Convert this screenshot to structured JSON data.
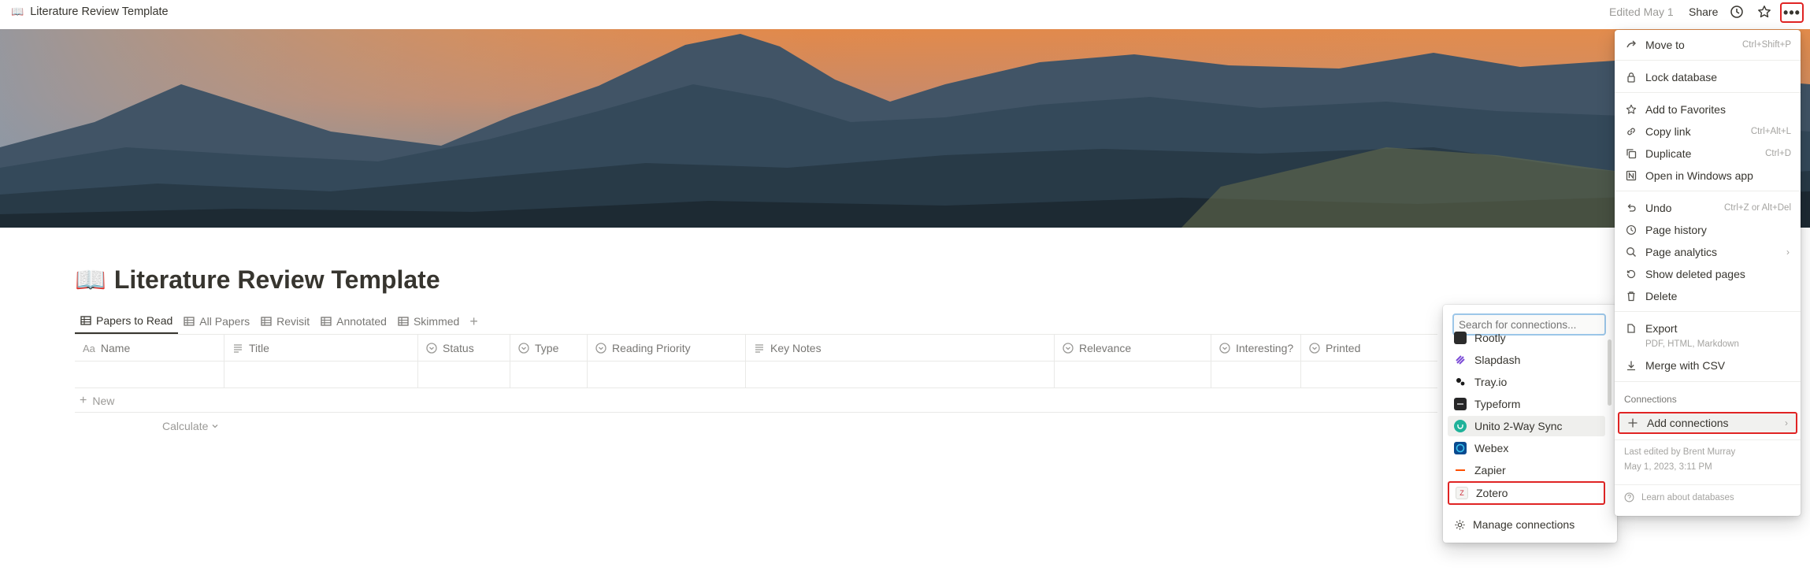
{
  "topbar": {
    "page_icon": "📖",
    "breadcrumb": "Literature Review Template",
    "edited": "Edited May 1",
    "share": "Share",
    "icons": [
      "history-icon",
      "star-icon",
      "more-icon"
    ]
  },
  "page": {
    "icon": "📖",
    "title": "Literature Review Template"
  },
  "tabs": [
    {
      "label": "Papers to Read",
      "active": true
    },
    {
      "label": "All Papers"
    },
    {
      "label": "Revisit"
    },
    {
      "label": "Annotated"
    },
    {
      "label": "Skimmed"
    }
  ],
  "table": {
    "columns": [
      {
        "icon": "Aa",
        "label": "Name"
      },
      {
        "icon": "text-icon",
        "label": "Title"
      },
      {
        "icon": "select-icon",
        "label": "Status"
      },
      {
        "icon": "select-icon",
        "label": "Type"
      },
      {
        "icon": "select-icon",
        "label": "Reading Priority"
      },
      {
        "icon": "text-icon",
        "label": "Key Notes"
      },
      {
        "icon": "select-icon",
        "label": "Relevance"
      },
      {
        "icon": "select-icon",
        "label": "Interesting?"
      },
      {
        "icon": "select-icon",
        "label": "Printed"
      }
    ],
    "new_label": "New",
    "calculate_label": "Calculate"
  },
  "connections_popup": {
    "search_placeholder": "Search for connections...",
    "items": [
      {
        "label": "Rootly",
        "color": "#2b2b2b"
      },
      {
        "label": "Slapdash",
        "color": "#7b4bd6"
      },
      {
        "label": "Tray.io",
        "color": "#1a1a1a"
      },
      {
        "label": "Typeform",
        "color": "#262627"
      },
      {
        "label": "Unito 2-Way Sync",
        "color": "#1fb29a"
      },
      {
        "label": "Webex",
        "color": "#0a4a8f"
      },
      {
        "label": "Zapier",
        "color": "#ff4f00"
      },
      {
        "label": "Zotero",
        "color": "#cc2936"
      }
    ],
    "manage_label": "Manage connections"
  },
  "more_menu": {
    "items": [
      {
        "label": "Move to",
        "shortcut": "Ctrl+Shift+P"
      },
      {
        "label": "Lock database"
      },
      {
        "label": "Add to Favorites"
      },
      {
        "label": "Copy link",
        "shortcut": "Ctrl+Alt+L"
      },
      {
        "label": "Duplicate",
        "shortcut": "Ctrl+D"
      },
      {
        "label": "Open in Windows app"
      },
      {
        "label": "Undo",
        "shortcut": "Ctrl+Z or Alt+Del"
      },
      {
        "label": "Page history"
      },
      {
        "label": "Page analytics"
      },
      {
        "label": "Show deleted pages"
      },
      {
        "label": "Delete"
      },
      {
        "label": "Export",
        "sub": "PDF, HTML, Markdown"
      },
      {
        "label": "Merge with CSV"
      }
    ],
    "connections_label": "Connections",
    "add_connections": "Add connections",
    "last_edited_by": "Last edited by Brent Murray",
    "last_edited_at": "May 1, 2023, 3:11 PM",
    "learn": "Learn about databases"
  },
  "accent": {
    "highlight_red": "#e02424",
    "focus_blue": "#9cc6e8"
  }
}
